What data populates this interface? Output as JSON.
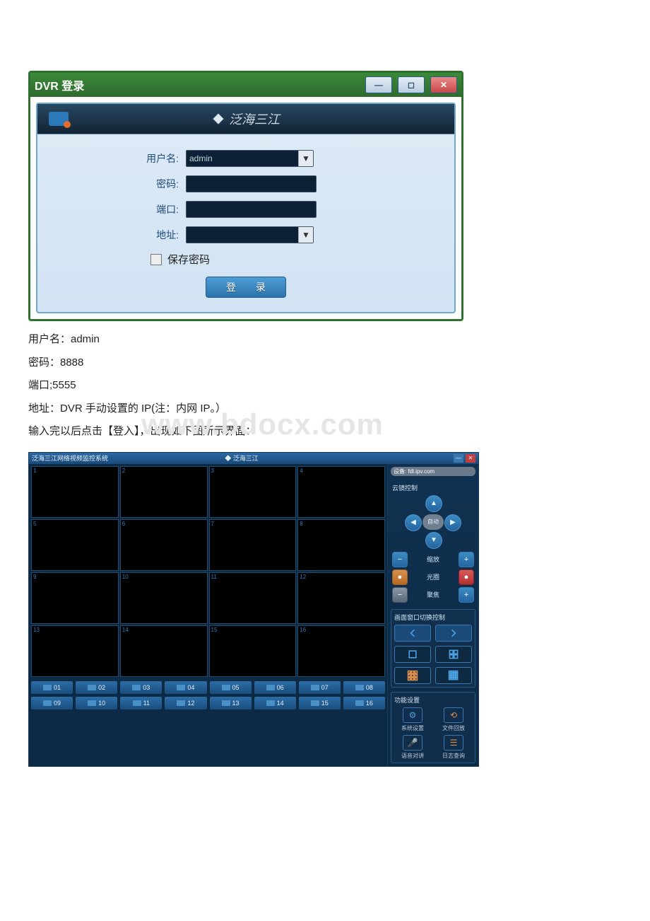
{
  "login_window": {
    "title": "DVR 登录",
    "brand": "泛海三江",
    "fields": {
      "username_label": "用户名:",
      "username_value": "admin",
      "password_label": "密码:",
      "port_label": "端口:",
      "address_label": "地址:",
      "save_pw_label": "保存密码"
    },
    "login_button": "登 录"
  },
  "doc": {
    "line1": "用户名：admin",
    "line2": "密码：8888",
    "line3": "端口;5555",
    "line4": "地址：DVR 手动设置的 IP(注：内网 IP。）",
    "line5": "输入完以后点击【登入】，出现如下图所示界面："
  },
  "watermark": "www.bdocx.com",
  "monitor": {
    "title": "泛海三江网络视频监控系统",
    "brand": "泛海三江",
    "device_label": "设备:  fdl.ipv.com",
    "ptz_title": "云镜控制",
    "ptz_center": "自动",
    "zoom_label": "缩放",
    "iris_label": "光圈",
    "focus_label": "聚焦",
    "layout_title": "画面窗口切换控制",
    "func_title": "功能设置",
    "func": {
      "sys": "系统设置",
      "playback": "文件回放",
      "talk": "语音对讲",
      "log": "日志查询"
    },
    "cells": [
      "1",
      "2",
      "3",
      "4",
      "5",
      "6",
      "7",
      "8",
      "9",
      "10",
      "11",
      "12",
      "13",
      "14",
      "15",
      "16"
    ],
    "channels": [
      "01",
      "02",
      "03",
      "04",
      "05",
      "06",
      "07",
      "08",
      "09",
      "10",
      "11",
      "12",
      "13",
      "14",
      "15",
      "16"
    ]
  }
}
